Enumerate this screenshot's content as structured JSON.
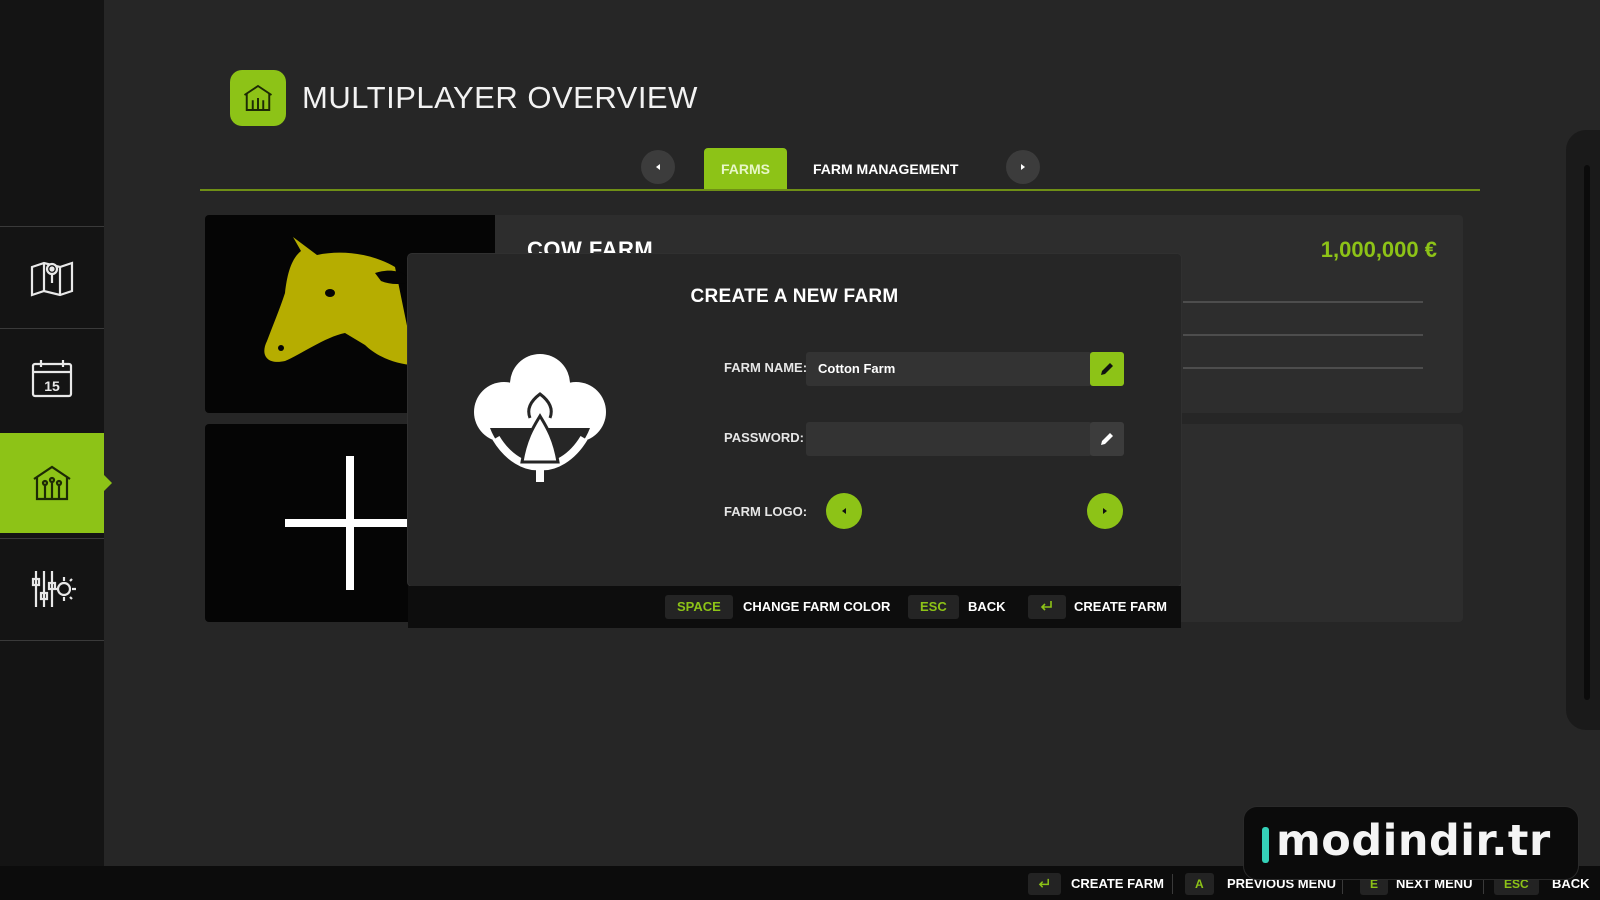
{
  "header": {
    "title": "MULTIPLAYER OVERVIEW",
    "icon": "barn-icon"
  },
  "sidebar": {
    "items": [
      {
        "icon": "map-icon",
        "active": false
      },
      {
        "icon": "calendar-icon",
        "label": "15",
        "active": false
      },
      {
        "icon": "barn-icon",
        "active": true
      },
      {
        "icon": "settings-sliders-icon",
        "active": false
      }
    ]
  },
  "tabs": {
    "items": [
      {
        "label": "FARMS",
        "active": true
      },
      {
        "label": "FARM MANAGEMENT",
        "active": false
      }
    ]
  },
  "farms": [
    {
      "name": "COW FARM",
      "money": "1,000,000 €",
      "logo": "cow-icon"
    },
    {
      "name": "",
      "logo": "plus-icon"
    }
  ],
  "dialog": {
    "title": "CREATE A NEW FARM",
    "logo": "cotton-icon",
    "farm_name_label": "FARM NAME:",
    "farm_name_value": "Cotton Farm",
    "password_label": "PASSWORD:",
    "password_value": "",
    "farm_logo_label": "FARM LOGO:",
    "footer": {
      "key1": "SPACE",
      "label1": "CHANGE FARM COLOR",
      "key2": "ESC",
      "label2": "BACK",
      "label3": "CREATE FARM"
    }
  },
  "bottom_bar": {
    "create_label": "CREATE FARM",
    "prev_key": "A",
    "prev_label": "PREVIOUS MENU",
    "next_key": "E",
    "next_label": "NEXT MENU",
    "back_key": "ESC",
    "back_label": "BACK"
  },
  "watermark": {
    "text": "modindir.tr"
  },
  "colors": {
    "accent": "#8dc317",
    "background": "#262626",
    "sidebar": "#141414",
    "money": "#8dc317"
  }
}
